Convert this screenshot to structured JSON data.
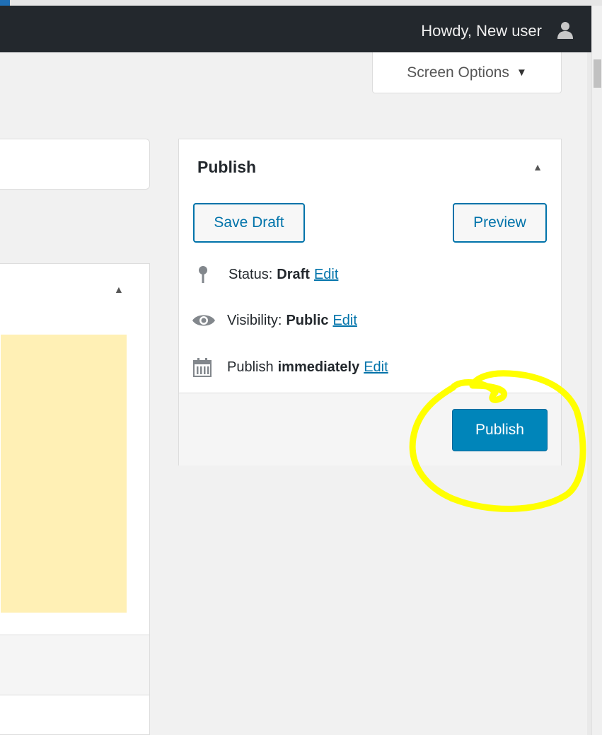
{
  "adminbar": {
    "greeting": "Howdy, New user",
    "avatar_icon": "user-icon"
  },
  "screen_options": {
    "label": "Screen Options",
    "caret": "▼"
  },
  "editor": {
    "toggle": "▲"
  },
  "publish": {
    "title": "Publish",
    "toggle": "▲",
    "save_draft_label": "Save Draft",
    "preview_label": "Preview",
    "status": {
      "icon": "pin-icon",
      "label": "Status:",
      "value": "Draft",
      "edit": "Edit"
    },
    "visibility": {
      "icon": "eye-icon",
      "label": "Visibility:",
      "value": "Public",
      "edit": "Edit"
    },
    "schedule": {
      "icon": "calendar-icon",
      "label": "Publish",
      "value": "immediately",
      "edit": "Edit"
    },
    "publish_button_label": "Publish"
  },
  "colors": {
    "adminbar_bg": "#23282d",
    "primary_button": "#0085ba",
    "link": "#0073aa",
    "notice_bg": "#fff0b5",
    "highlight": "#ffff00"
  }
}
